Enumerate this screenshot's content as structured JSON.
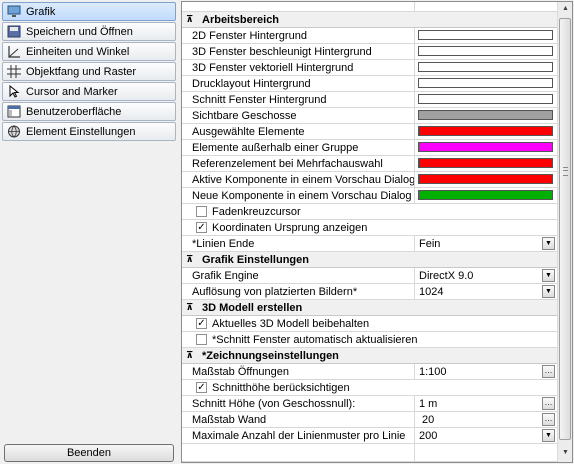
{
  "nav": {
    "items": [
      {
        "label": "Grafik",
        "icon": "monitor-icon",
        "selected": true
      },
      {
        "label": "Speichern und Öffnen",
        "icon": "floppy-disk-icon"
      },
      {
        "label": "Einheiten und Winkel",
        "icon": "angle-icon"
      },
      {
        "label": "Objektfang und Raster",
        "icon": "grid-icon"
      },
      {
        "label": "Cursor and Marker",
        "icon": "cursor-icon"
      },
      {
        "label": "Benutzeroberfläche",
        "icon": "window-icon"
      },
      {
        "label": "Element Einstellungen",
        "icon": "globe-icon"
      }
    ],
    "exit_label": "Beenden"
  },
  "sections": {
    "arbeitsbereich": {
      "title": "Arbeitsbereich",
      "rows": [
        {
          "label": "2D Fenster Hintergrund",
          "color": "#ffffff"
        },
        {
          "label": "3D Fenster beschleunigt Hintergrund",
          "color": "#ffffff"
        },
        {
          "label": "3D Fenster vektoriell Hintergrund",
          "color": "#ffffff"
        },
        {
          "label": "Drucklayout Hintergrund",
          "color": "#ffffff"
        },
        {
          "label": "Schnitt Fenster Hintergrund",
          "color": "#ffffff"
        },
        {
          "label": "Sichtbare Geschosse",
          "color": "#a0a0a0"
        },
        {
          "label": "Ausgewählte Elemente",
          "color": "#ff0000"
        },
        {
          "label": "Elemente außerhalb einer Gruppe",
          "color": "#ff00ff"
        },
        {
          "label": "Referenzelement bei Mehrfachauswahl",
          "color": "#ff0000"
        },
        {
          "label": "Aktive Komponente in einem Vorschau Dialog",
          "color": "#ff0000"
        },
        {
          "label": "Neue Komponente in einem Vorschau Dialog",
          "color": "#00b000"
        }
      ],
      "checks": [
        {
          "label": "Fadenkreuzcursor",
          "checked": false
        },
        {
          "label": "Koordinaten Ursprung anzeigen",
          "checked": true
        }
      ],
      "linien_ende": {
        "label": "*Linien Ende",
        "value": "Fein"
      }
    },
    "grafik": {
      "title": "Grafik Einstellungen",
      "engine": {
        "label": "Grafik Engine",
        "value": "DirectX 9.0"
      },
      "aufloesung": {
        "label": "Auflösung von platzierten Bildern*",
        "value": "1024"
      }
    },
    "modell": {
      "title": "3D Modell erstellen",
      "checks": [
        {
          "label": "Aktuelles 3D Modell beibehalten",
          "checked": true
        },
        {
          "label": "*Schnitt Fenster automatisch aktualisieren",
          "checked": false
        }
      ]
    },
    "zeichnung": {
      "title": "*Zeichnungseinstellungen",
      "massstab_oeffnungen": {
        "label": "Maßstab Öffnungen",
        "value": "1:100"
      },
      "schnitthoehe": {
        "label": "Schnitthöhe berücksichtigen",
        "checked": true
      },
      "schnitt_hoehe": {
        "label": "Schnitt Höhe (von Geschossnull):",
        "value": "1 m"
      },
      "massstab_wand": {
        "label": "Maßstab Wand",
        "value": "20"
      },
      "linienmuster": {
        "label": "Maximale Anzahl der Linienmuster pro Linie",
        "value": "200"
      }
    }
  },
  "glyphs": {
    "collapse": "⊼",
    "check": "✓",
    "dropdown": "▼",
    "ellipsis": "…",
    "up": "▲",
    "down": "▼"
  }
}
